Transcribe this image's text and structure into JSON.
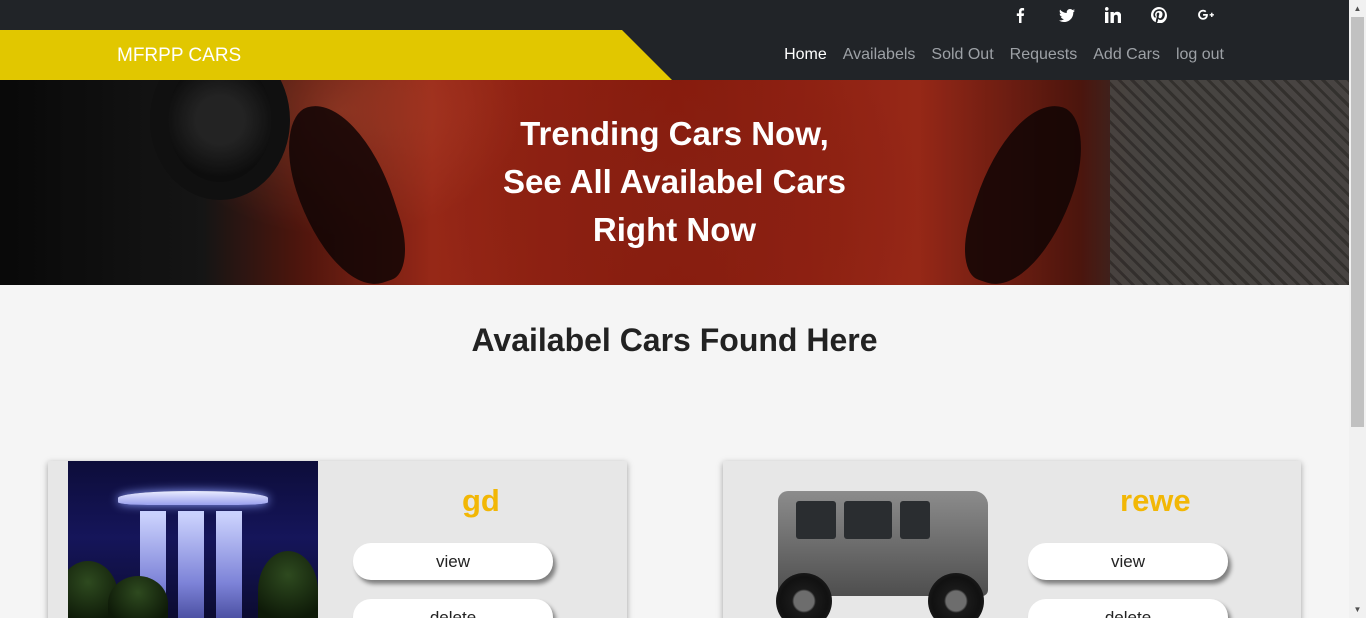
{
  "social": [
    {
      "name": "facebook-icon"
    },
    {
      "name": "twitter-icon"
    },
    {
      "name": "linkedin-icon"
    },
    {
      "name": "pinterest-icon"
    },
    {
      "name": "google-plus-icon"
    }
  ],
  "nav": {
    "brand": "MFRPP CARS",
    "links": [
      "Home",
      "Availabels",
      "Sold Out",
      "Requests",
      "Add Cars",
      "log out"
    ],
    "active": "Home"
  },
  "hero": {
    "line1": "Trending Cars Now,",
    "line2": "See All Availabel Cars",
    "line3": "Right Now"
  },
  "section": {
    "title": "Availabel Cars Found Here"
  },
  "cars": [
    {
      "name": "gd",
      "view_label": "view",
      "delete_label": "delete"
    },
    {
      "name": "rewe",
      "view_label": "view",
      "delete_label": "delete"
    }
  ],
  "colors": {
    "brand_yellow": "#e1c700",
    "nav_dark": "#212428",
    "car_name": "#f2b705"
  }
}
